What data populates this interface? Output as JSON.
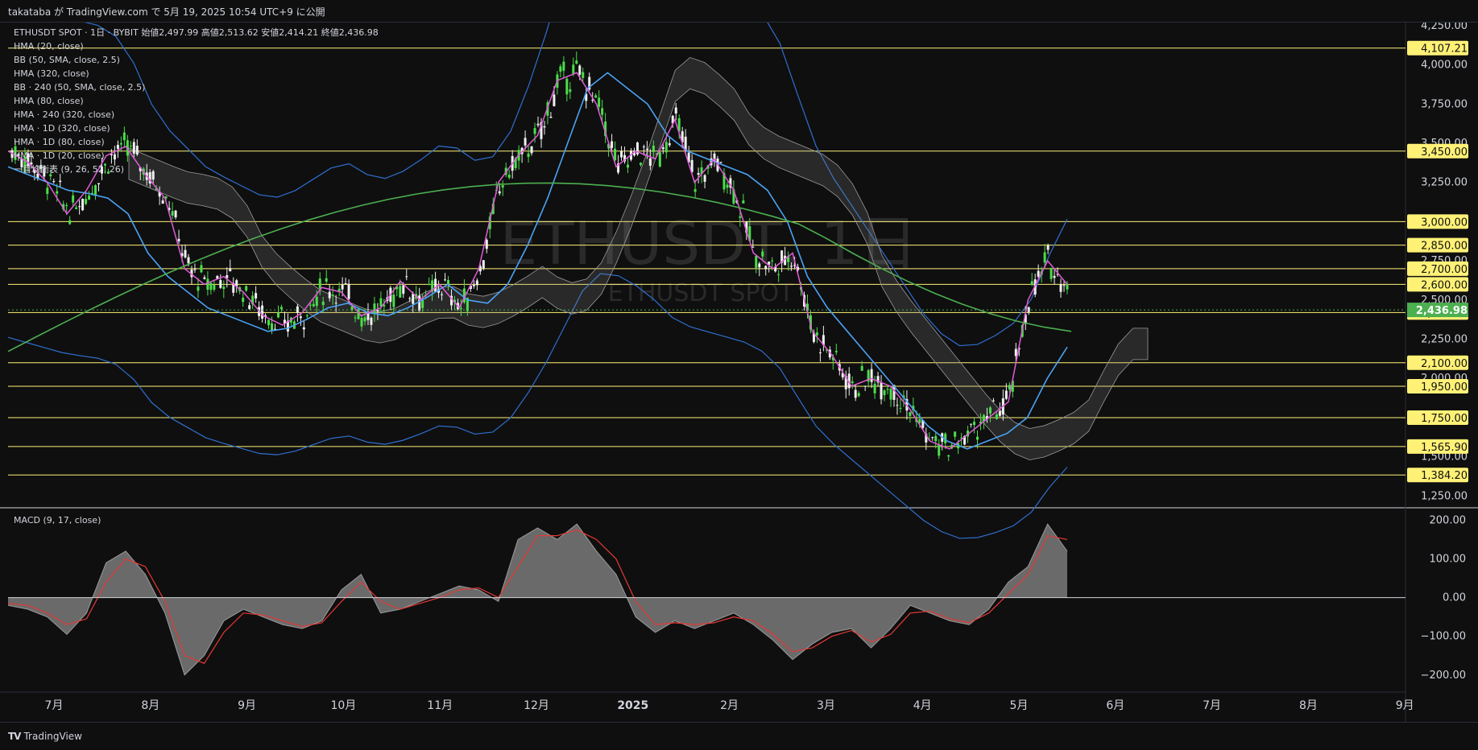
{
  "header": {
    "publish_text": "takataba が TradingView.com で 5月 19, 2025 10:54 UTC+9 に公開"
  },
  "legend": {
    "symbol": "ETHUSDT SPOT · 1日 · BYBIT",
    "ohlc": "始値2,497.99 高値2,513.62 安値2,414.21 終値2,436.98",
    "indicators": [
      "HMA (20, close)",
      "BB (50, SMA, close, 2.5)",
      "HMA (320, close)",
      "BB · 240 (50, SMA, close, 2.5)",
      "HMA (80, close)",
      "HMA · 240 (320, close)",
      "HMA · 1D (320, close)",
      "HMA · 1D (80, close)",
      "HMA · 1D (20, close)",
      "一目均衡表 (9, 26, 52, 26)"
    ]
  },
  "watermark": {
    "main": "ETHUSDT, 1日",
    "sub": "ETHUSDT SPOT"
  },
  "macd_legend": "MACD (9, 17, close)",
  "footer": {
    "brand": "TradingView"
  },
  "colors": {
    "up": "#4ade4a",
    "down": "#f0f0f0",
    "level": "#fff176",
    "level_label_bg": "#fff176",
    "hma20": "#e05cd8",
    "hma80": "#4aa3f5",
    "hma320": "#4caf50",
    "bb": "#2f6fd0",
    "cloud": "#8a8a8a",
    "macd_fill": "#7a7a7a",
    "signal": "#e53935",
    "last_price_bg": "#4caf50"
  },
  "chart_data": [
    {
      "type": "candlestick",
      "title": "",
      "x_ticks": [
        "7月",
        "8月",
        "9月",
        "10月",
        "11月",
        "12月",
        "2025",
        "2月",
        "3月",
        "4月",
        "5月",
        "6月",
        "7月",
        "8月",
        "9月"
      ],
      "y_ticks": [
        "4,250.00",
        "4,000.00",
        "3,750.00",
        "3,500.00",
        "3,250.00",
        "3,000.00",
        "2,750.00",
        "2,500.00",
        "2,250.00",
        "2,000.00",
        "1,750.00",
        "1,500.00",
        "1,250.00"
      ],
      "ylim": [
        1180,
        4270
      ],
      "last_price": "2,436.98",
      "levels": [
        {
          "label": "4,107.21",
          "value": 4107.21
        },
        {
          "label": "3,450.00",
          "value": 3450
        },
        {
          "label": "3,000.00",
          "value": 3000
        },
        {
          "label": "2,850.00",
          "value": 2850
        },
        {
          "label": "2,700.00",
          "value": 2700
        },
        {
          "label": "2,600.00",
          "value": 2600
        },
        {
          "label": "2,420.00",
          "value": 2420
        },
        {
          "label": "2,100.00",
          "value": 2100
        },
        {
          "label": "1,950.00",
          "value": 1950
        },
        {
          "label": "1,750.00",
          "value": 1750
        },
        {
          "label": "1,565.90",
          "value": 1565.9
        },
        {
          "label": "1,384.20",
          "value": 1384.2
        }
      ],
      "series": [
        {
          "name": "HMA (20, close)",
          "values": [
            3450,
            3380,
            3250,
            3050,
            3200,
            3420,
            3480,
            3300,
            3150,
            2700,
            2600,
            2650,
            2550,
            2400,
            2340,
            2420,
            2580,
            2550,
            2400,
            2450,
            2620,
            2500,
            2600,
            2450,
            2700,
            3250,
            3420,
            3550,
            3900,
            3950,
            3750,
            3350,
            3450,
            3400,
            3650,
            3250,
            3400,
            3200,
            2800,
            2700,
            2800,
            2300,
            2150,
            1950,
            2000,
            1950,
            1800,
            1600,
            1550,
            1650,
            1750,
            1850,
            2500,
            2750,
            2600
          ]
        },
        {
          "name": "HMA (80, close)",
          "values": [
            3350,
            3300,
            3250,
            3200,
            3180,
            3150,
            3050,
            2800,
            2650,
            2550,
            2450,
            2400,
            2350,
            2300,
            2320,
            2380,
            2450,
            2480,
            2420,
            2400,
            2450,
            2520,
            2600,
            2500,
            2480,
            2600,
            2850,
            3150,
            3500,
            3850,
            3950,
            3850,
            3750,
            3550,
            3450,
            3400,
            3350,
            3300,
            3200,
            3000,
            2650,
            2450,
            2300,
            2150,
            2000,
            1850,
            1700,
            1600,
            1550,
            1600,
            1650,
            1750,
            2000,
            2200
          ]
        }
      ]
    },
    {
      "type": "area",
      "title": "MACD (9, 17, close)",
      "y_ticks": [
        "200.00",
        "100.00",
        "0.00",
        "−100.00",
        "−200.00"
      ],
      "ylim": [
        -240,
        230
      ],
      "series": [
        {
          "name": "MACD",
          "values": [
            -20,
            -30,
            -50,
            -95,
            -40,
            90,
            120,
            60,
            -40,
            -200,
            -150,
            -60,
            -30,
            -50,
            -70,
            -80,
            -60,
            20,
            60,
            -40,
            -30,
            -10,
            10,
            30,
            20,
            -10,
            150,
            180,
            150,
            190,
            120,
            60,
            -50,
            -90,
            -60,
            -80,
            -60,
            -40,
            -70,
            -110,
            -160,
            -120,
            -90,
            -80,
            -130,
            -80,
            -20,
            -40,
            -60,
            -70,
            -30,
            40,
            80,
            190,
            120
          ]
        },
        {
          "name": "Signal",
          "values": [
            -15,
            -20,
            -40,
            -70,
            -55,
            40,
            100,
            80,
            -10,
            -150,
            -170,
            -90,
            -40,
            -45,
            -60,
            -75,
            -65,
            -10,
            40,
            -10,
            -30,
            -15,
            0,
            20,
            25,
            0,
            80,
            160,
            160,
            175,
            150,
            100,
            -10,
            -70,
            -65,
            -70,
            -65,
            -50,
            -60,
            -95,
            -140,
            -130,
            -100,
            -85,
            -115,
            -95,
            -40,
            -35,
            -55,
            -65,
            -40,
            10,
            60,
            160,
            150
          ]
        }
      ]
    }
  ]
}
